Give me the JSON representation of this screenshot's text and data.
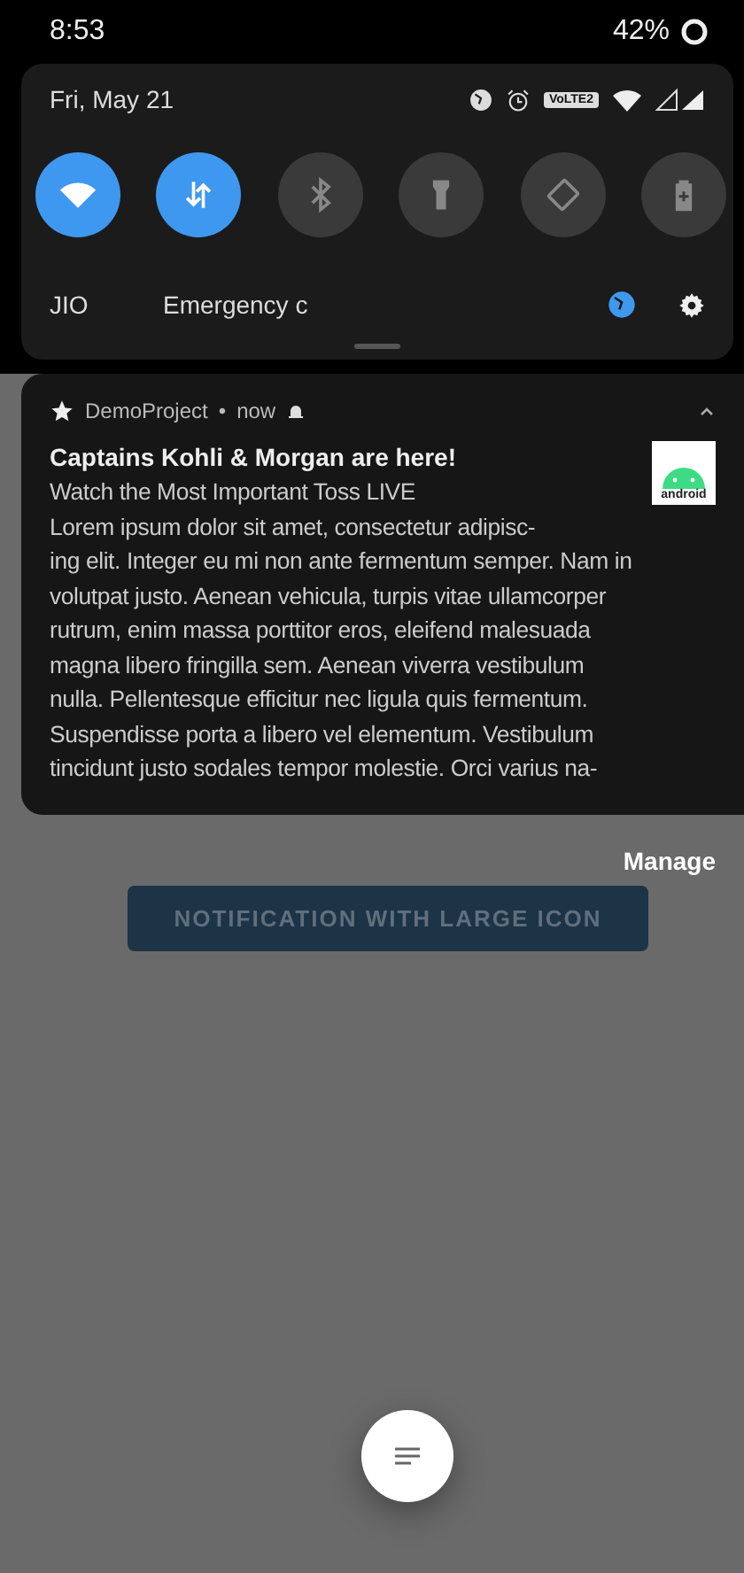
{
  "status_bar": {
    "time": "8:53",
    "battery": "42%"
  },
  "quick_settings": {
    "date": "Fri, May 21",
    "volte": "VoLTE2",
    "tiles": [
      {
        "kind": "wifi",
        "on": true
      },
      {
        "kind": "data",
        "on": true
      },
      {
        "kind": "bluetooth",
        "on": false
      },
      {
        "kind": "flashlight",
        "on": false
      },
      {
        "kind": "rotate",
        "on": false
      },
      {
        "kind": "battery",
        "on": false
      }
    ],
    "carrier": "JIO",
    "emergency": "Emergency c"
  },
  "notification": {
    "app": "DemoProject",
    "separator": "•",
    "time": "now",
    "title": "Captains Kohli & Morgan are here!",
    "subtitle": "Watch the Most Important Toss LIVE",
    "large_icon_label": "android",
    "body": [
      "Lorem ipsum dolor sit amet, consectetur adipisc-",
      "ing elit. Integer eu mi non ante fermentum semper. Nam in",
      "volutpat justo. Aenean vehicula, turpis vitae ullamcorper",
      "rutrum, enim massa porttitor eros, eleifend malesuada",
      "magna libero fringilla sem. Aenean viverra vestibulum",
      "nulla. Pellentesque efficitur nec ligula quis fermentum.",
      "Suspendisse porta a libero vel elementum. Vestibulum",
      "tincidunt justo sodales tempor molestie. Orci varius na-"
    ]
  },
  "manage": "Manage",
  "app_button": "NOTIFICATION WITH LARGE ICON"
}
